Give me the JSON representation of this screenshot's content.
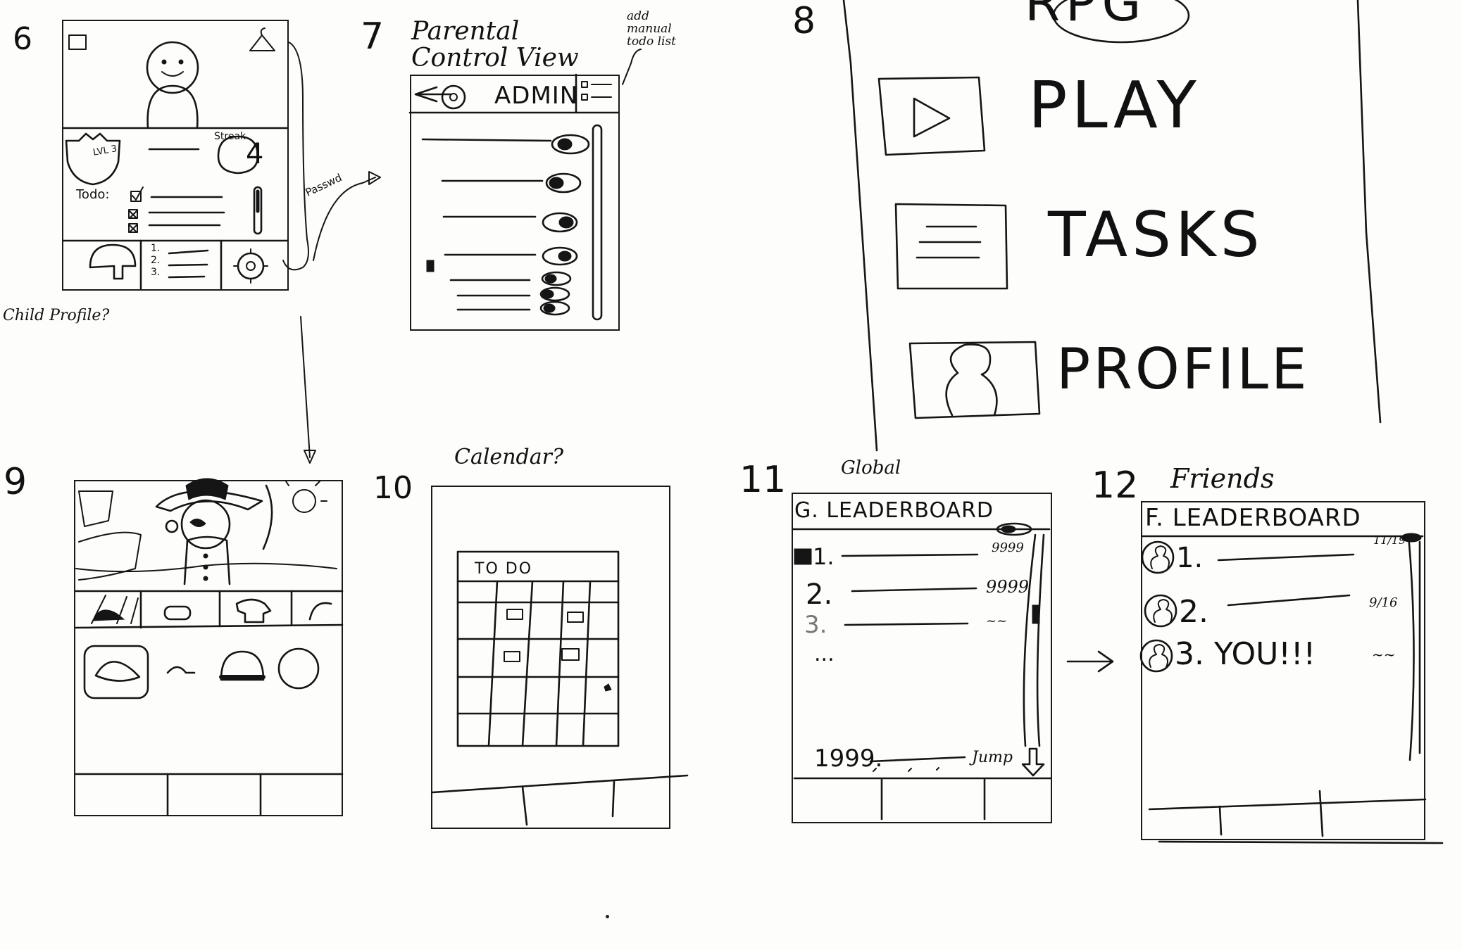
{
  "sketch_numbers": [
    "6",
    "7",
    "8",
    "9",
    "10",
    "11",
    "12"
  ],
  "screen6": {
    "level_badge": "LVL 3",
    "streak_label": "Streak",
    "streak_value": "4",
    "todo_label": "Todo:",
    "list_numbers": [
      "1.",
      "2.",
      "3."
    ],
    "caption": "Child Profile?",
    "arrow_label": "Passwd"
  },
  "screen7": {
    "title": "Parental Control View",
    "header": "ADMIN",
    "annotation": "add manual todo list"
  },
  "screen8": {
    "title_partial": "RPG",
    "menu": [
      "PLAY",
      "TASKS",
      "PROFILE"
    ]
  },
  "screen10": {
    "caption": "Calendar?",
    "grid_title": "TO DO"
  },
  "screen11": {
    "caption": "Global",
    "header": "G. LEADERBOARD",
    "ranks": [
      "1.",
      "2.",
      "3.",
      "..."
    ],
    "scores": [
      "9999",
      "9999",
      "~~"
    ],
    "bottom_rank": "1999.",
    "jump_label": "Jump"
  },
  "screen12": {
    "caption": "Friends",
    "header": "F. LEADERBOARD",
    "ranks": [
      "1.",
      "2.",
      "3. YOU!!!"
    ],
    "scores": [
      "11/19",
      "9/16",
      "~~"
    ]
  }
}
